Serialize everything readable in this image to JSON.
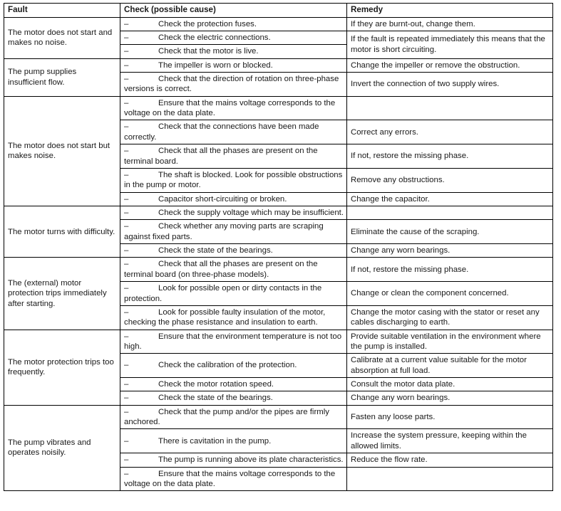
{
  "document": {
    "type": "troubleshooting-table",
    "text_color": "#1a1a1a",
    "border_color": "#000000",
    "background": "#ffffff"
  },
  "table": {
    "headers": {
      "fault": "Fault",
      "check": "Check (possible cause)",
      "remedy": "Remedy"
    },
    "bullet_marker": "–",
    "rows": [
      {
        "fault": "The motor does not start and makes no noise.",
        "fault_rowspan": 3,
        "checks": [
          {
            "text": "Check the protection fuses."
          },
          {
            "text": "Check the electric connections."
          },
          {
            "text": "Check that the motor is live."
          }
        ],
        "remedies": [
          {
            "text": "If they are burnt-out, change them.",
            "rowspan": 1
          },
          {
            "text": "If the fault is repeated immediately this means that the motor is short circuiting.",
            "rowspan": 2
          }
        ]
      },
      {
        "fault": "The pump supplies insufficient flow.",
        "fault_rowspan": 2,
        "checks": [
          {
            "text": "The impeller is worn or blocked."
          },
          {
            "text": "Check that the direction of rotation on three-phase versions is correct."
          }
        ],
        "remedies": [
          {
            "text": "Change the impeller or remove the obstruction.",
            "rowspan": 1
          },
          {
            "text": "Invert the connection of two supply wires.",
            "rowspan": 1
          }
        ]
      },
      {
        "fault": "The motor does not start but makes noise.",
        "fault_rowspan": 5,
        "checks": [
          {
            "text": "Ensure that the mains voltage corresponds to the voltage on the data plate."
          },
          {
            "text": "Check that the connections have been made correctly."
          },
          {
            "text": "Check that all the phases are present on the terminal board."
          },
          {
            "text": "The shaft is blocked. Look for possible obstructions in the pump or motor."
          },
          {
            "text": "Capacitor short-circuiting or broken."
          }
        ],
        "remedies": [
          {
            "text": "",
            "rowspan": 1
          },
          {
            "text": "Correct any errors.",
            "rowspan": 1
          },
          {
            "text": "If not, restore the missing phase.",
            "rowspan": 1
          },
          {
            "text": "Remove any obstructions.",
            "rowspan": 1
          },
          {
            "text": "Change the capacitor.",
            "rowspan": 1
          }
        ]
      },
      {
        "fault": "The motor turns with difficulty.",
        "fault_rowspan": 3,
        "checks": [
          {
            "text": "Check the supply voltage which may be insufficient."
          },
          {
            "text": "Check whether any moving parts are scraping against fixed parts."
          },
          {
            "text": "Check the state of the bearings."
          }
        ],
        "remedies": [
          {
            "text": "",
            "rowspan": 1
          },
          {
            "text": "Eliminate the cause of the scraping.",
            "rowspan": 1
          },
          {
            "text": "Change any worn bearings.",
            "rowspan": 1
          }
        ]
      },
      {
        "fault": "The (external) motor protection trips immediately after starting.",
        "fault_rowspan": 3,
        "checks": [
          {
            "text": "Check that all the phases are present on the terminal board (on three-phase models)."
          },
          {
            "text": "Look for possible open or dirty contacts in the protection."
          },
          {
            "text": "Look for possible faulty insulation of the motor, checking the phase resistance and insulation to earth."
          }
        ],
        "remedies": [
          {
            "text": "If not, restore the missing phase.",
            "rowspan": 1
          },
          {
            "text": "Change or clean the component concerned.",
            "rowspan": 1
          },
          {
            "text": "Change the motor casing with the stator or reset any cables discharging to earth.",
            "rowspan": 1
          }
        ]
      },
      {
        "fault": "The motor protection trips too frequently.",
        "fault_rowspan": 4,
        "checks": [
          {
            "text": "Ensure that the environment temperature is not too high."
          },
          {
            "text": "Check the calibration of the protection."
          },
          {
            "text": "Check the motor rotation speed."
          },
          {
            "text": "Check the state of the bearings."
          }
        ],
        "remedies": [
          {
            "text": "Provide suitable ventilation in the environment where the pump is installed.",
            "rowspan": 1
          },
          {
            "text": "Calibrate at a current value suitable for the motor absorption at full load.",
            "rowspan": 1
          },
          {
            "text": "Consult the motor data plate.",
            "rowspan": 1
          },
          {
            "text": "Change any worn bearings.",
            "rowspan": 1
          }
        ]
      },
      {
        "fault": "The pump vibrates and operates noisily.",
        "fault_rowspan": 4,
        "checks": [
          {
            "text": "Check that the pump and/or the pipes are firmly anchored."
          },
          {
            "text": "There is cavitation in the pump."
          },
          {
            "text": "The pump is running above its plate characteristics."
          },
          {
            "text": "Ensure that the mains voltage corresponds to the voltage on the data plate."
          }
        ],
        "remedies": [
          {
            "text": "Fasten any loose parts.",
            "rowspan": 1
          },
          {
            "text": "Increase the system pressure, keeping within the allowed limits.",
            "rowspan": 1
          },
          {
            "text": "Reduce the flow rate.",
            "rowspan": 1
          },
          {
            "text": "",
            "rowspan": 1
          }
        ]
      }
    ]
  }
}
